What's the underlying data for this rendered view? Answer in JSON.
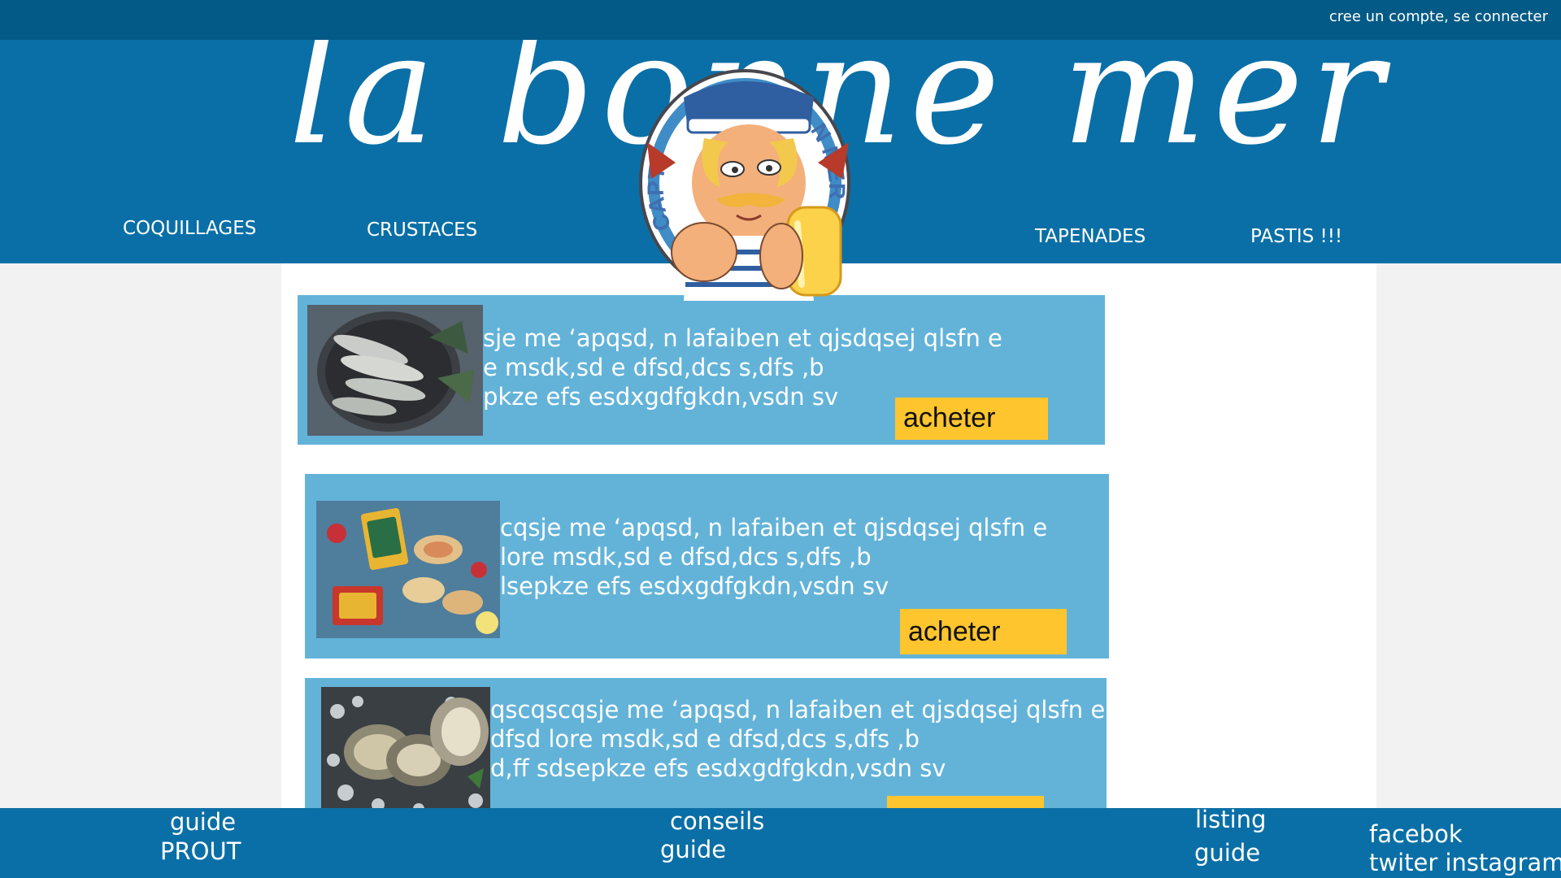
{
  "topbar": {
    "account_link": "cree un compte, se connecter"
  },
  "header": {
    "logo_text": "la bonne mer",
    "nav": [
      "COQUILLAGES",
      "CRUSTACES",
      "TAPENADES",
      "PASTIS !!!"
    ]
  },
  "mascot": {
    "left_text": "CAPT",
    "right_text": "N MER"
  },
  "products": [
    {
      "image_icon": "sardines-plate-image",
      "lines": [
        "sje me ‘apqsd, n lafaiben et qjsdqsej qlsfn e",
        "e msdk,sd e dfsd,dcs s,dfs ,b",
        "pkze efs esdxgdfgkdn,vsdn sv"
      ],
      "buy_label": "acheter"
    },
    {
      "image_icon": "sardine-tins-image",
      "lines": [
        "cqsje me ‘apqsd, n lafaiben et qjsdqsej qlsfn e",
        "lore msdk,sd e dfsd,dcs s,dfs ,b",
        "lsepkze efs esdxgdfgkdn,vsdn sv"
      ],
      "buy_label": "acheter"
    },
    {
      "image_icon": "oysters-on-ice-image",
      "lines": [
        "qscqscqsje me ‘apqsd, n lafaiben et qjsdqsej qlsfn e",
        "dfsd lore msdk,sd e dfsd,dcs s,dfs ,b",
        "d,ff sdsepkze efs esdxgdfgkdn,vsdn sv"
      ],
      "buy_label": ""
    }
  ],
  "footer": {
    "col1": [
      "guide",
      "PROUT"
    ],
    "col2": [
      "conseils",
      "guide"
    ],
    "col3": [
      "listing",
      "guide"
    ],
    "col4": [
      "facebok",
      "twiter instagram"
    ]
  },
  "colors": {
    "topbar": "#045a86",
    "header": "#0a6fa6",
    "card": "#63b3d9",
    "button": "#fec52e"
  }
}
